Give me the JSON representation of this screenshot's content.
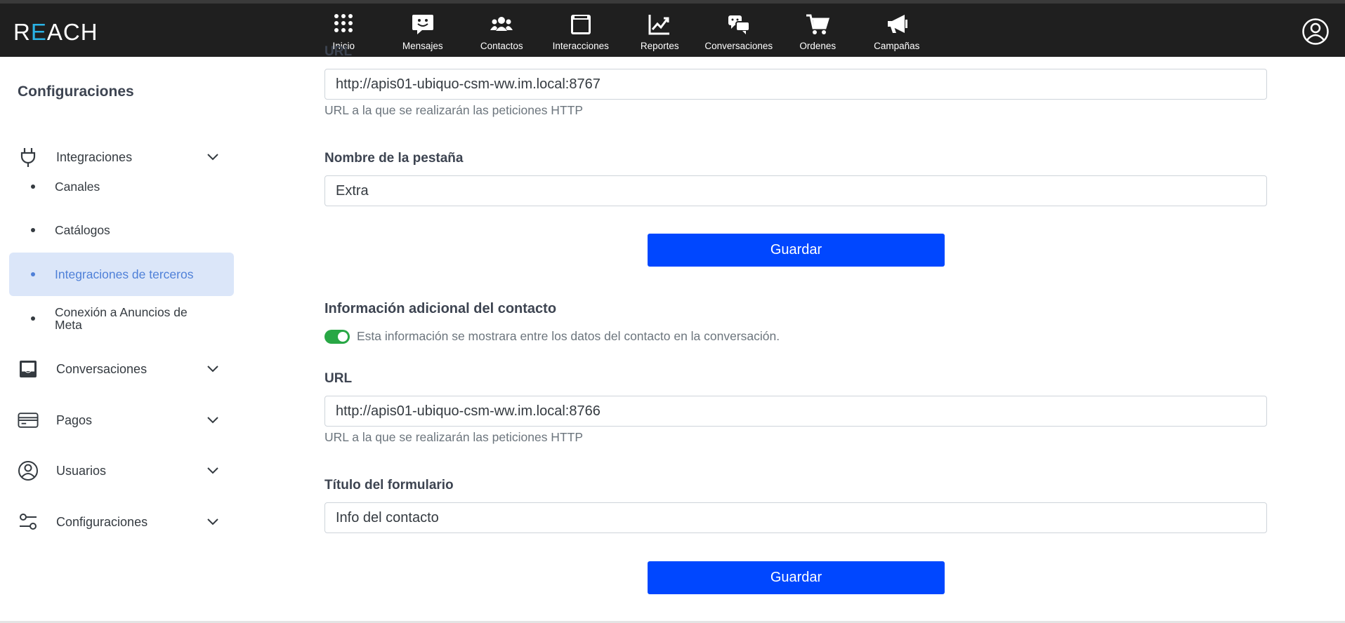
{
  "app": {
    "logo_prefix": "R",
    "logo_e": "E",
    "logo_suffix": "ACH"
  },
  "nav": [
    {
      "label": "Inicio",
      "icon": "grid-dots-icon"
    },
    {
      "label": "Mensajes",
      "icon": "chat-smile-icon"
    },
    {
      "label": "Contactos",
      "icon": "users-icon"
    },
    {
      "label": "Interacciones",
      "icon": "window-icon"
    },
    {
      "label": "Reportes",
      "icon": "chart-line-icon"
    },
    {
      "label": "Conversaciones",
      "icon": "chat-bubbles-icon"
    },
    {
      "label": "Ordenes",
      "icon": "cart-icon"
    },
    {
      "label": "Campañas",
      "icon": "megaphone-icon"
    }
  ],
  "sidebar": {
    "title": "Configuraciones",
    "groups": [
      {
        "label": "Integraciones",
        "icon": "plug-icon"
      },
      {
        "label": "Conversaciones",
        "icon": "inbox-icon"
      },
      {
        "label": "Pagos",
        "icon": "credit-card-icon"
      },
      {
        "label": "Usuarios",
        "icon": "user-circle-icon"
      },
      {
        "label": "Configuraciones",
        "icon": "sliders-icon"
      }
    ],
    "sub_items": [
      {
        "label": "Canales",
        "active": false
      },
      {
        "label": "Catálogos",
        "active": false
      },
      {
        "label": "Integraciones de terceros",
        "active": true
      },
      {
        "label": "Conexión a Anuncios de Meta",
        "active": false
      }
    ]
  },
  "form_top": {
    "cut_label": "URL",
    "url_value": "http://apis01-ubiquo-csm-ww.im.local:8767",
    "url_help": "URL a la que se realizarán las peticiones HTTP",
    "tab_name_label": "Nombre de la pestaña",
    "tab_name_value": "Extra",
    "save_label": "Guardar"
  },
  "form_contact": {
    "title": "Información adicional del contacto",
    "toggle_on": true,
    "toggle_text": "Esta información se mostrara entre los datos del contacto en la conversación.",
    "url_label": "URL",
    "url_value": "http://apis01-ubiquo-csm-ww.im.local:8766",
    "url_help": "URL a la que se realizarán las peticiones HTTP",
    "form_title_label": "Título del formulario",
    "form_title_value": "Info del contacto",
    "save_label": "Guardar"
  },
  "colors": {
    "topbar": "#1f1f1f",
    "accent": "#0047ff",
    "active_bg": "#dbe6f9",
    "active_text": "#4f80d8",
    "toggle": "#28a745"
  }
}
